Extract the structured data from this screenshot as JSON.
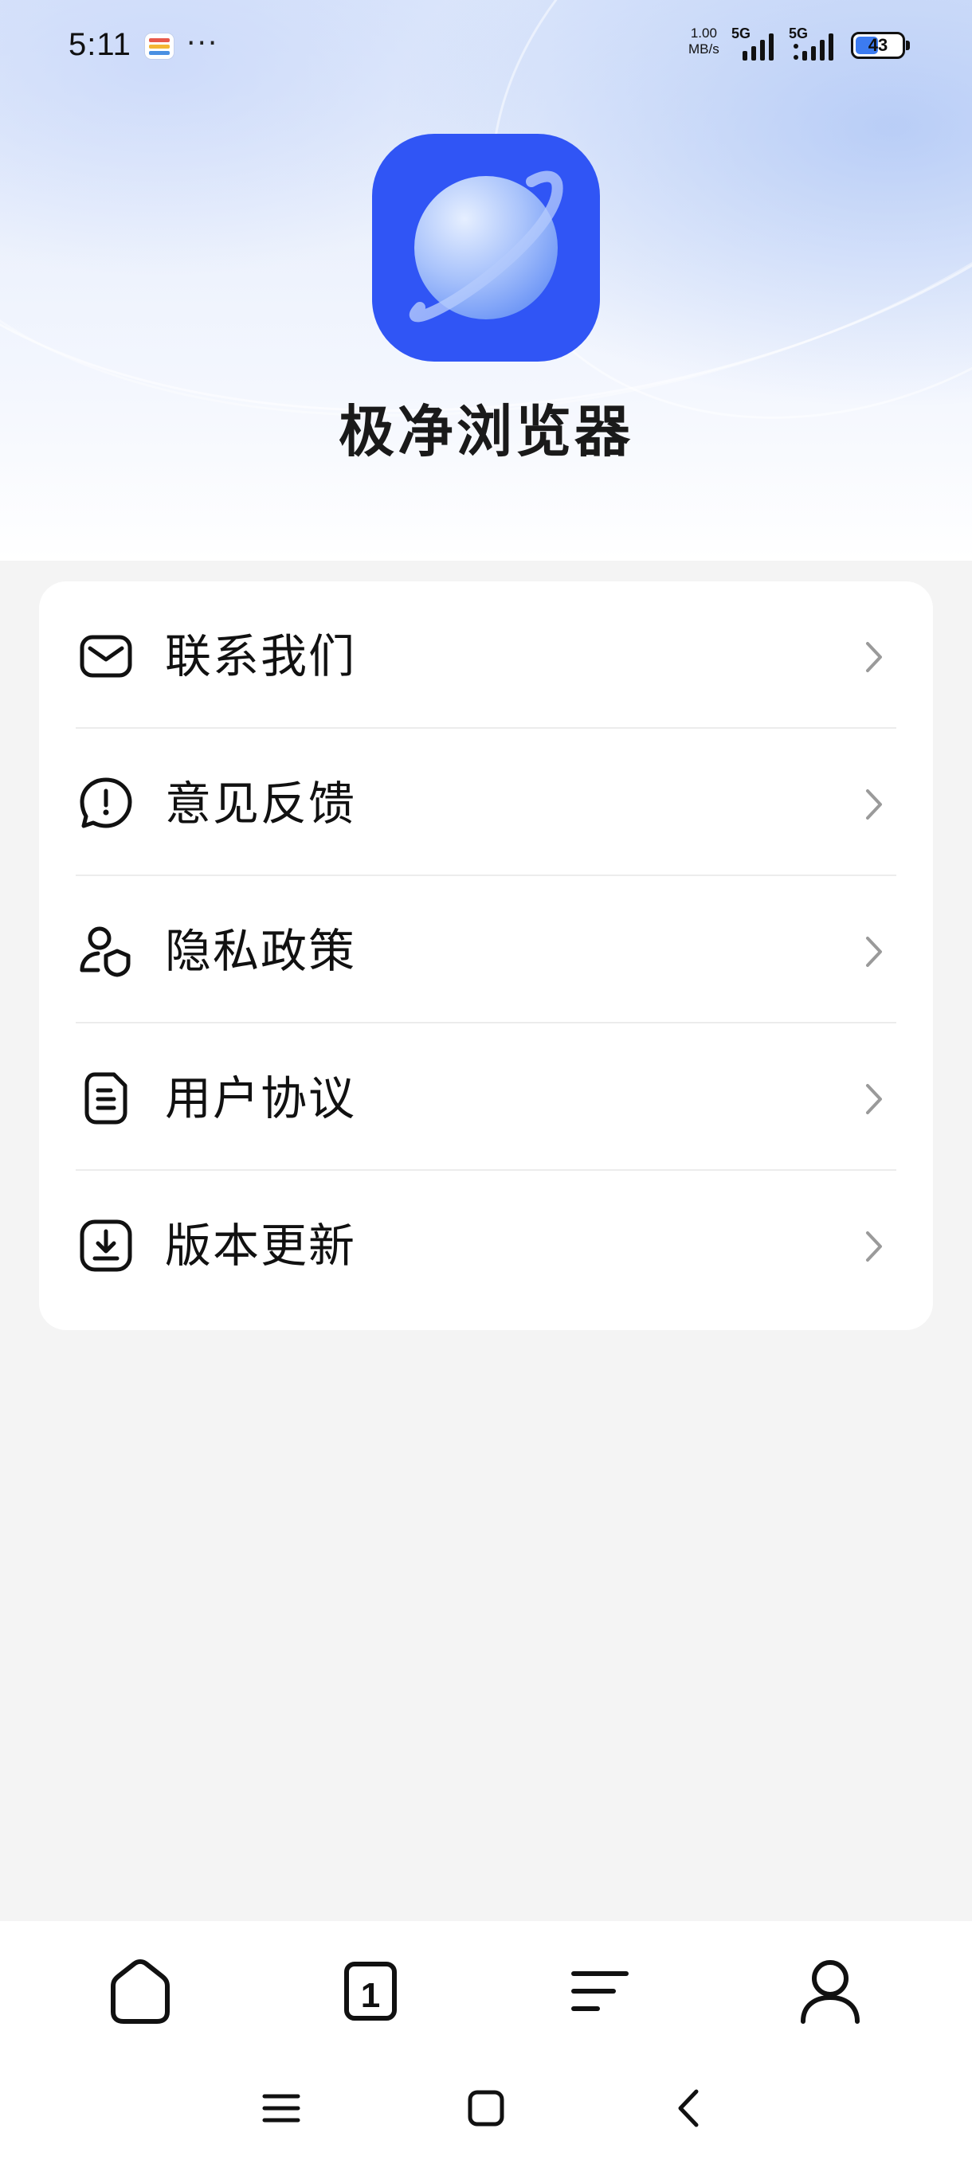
{
  "status_bar": {
    "time": "5:11",
    "more": "···",
    "net_speed_value": "1.00",
    "net_speed_unit": "MB/s",
    "network_1": "5G",
    "network_2": "5G",
    "battery_level": "43",
    "battery_color": "#3c7bf0"
  },
  "app": {
    "name": "极净浏览器",
    "logo_icon": "planet-icon",
    "brand_color": "#3055f5"
  },
  "menu": {
    "items": [
      {
        "label": "联系我们",
        "icon": "mail-icon"
      },
      {
        "label": "意见反馈",
        "icon": "feedback-bubble-icon"
      },
      {
        "label": "隐私政策",
        "icon": "user-shield-icon"
      },
      {
        "label": "用户协议",
        "icon": "document-icon"
      },
      {
        "label": "版本更新",
        "icon": "download-box-icon"
      }
    ]
  },
  "bottom_nav": {
    "items": [
      {
        "name": "home",
        "icon": "home-icon"
      },
      {
        "name": "tabs",
        "icon": "tab-count-icon",
        "count": "1"
      },
      {
        "name": "menu",
        "icon": "menu-lines-icon"
      },
      {
        "name": "profile",
        "icon": "person-icon"
      }
    ]
  },
  "system_nav": {
    "items": [
      "recent-apps-icon",
      "home-square-icon",
      "back-chevron-icon"
    ]
  }
}
